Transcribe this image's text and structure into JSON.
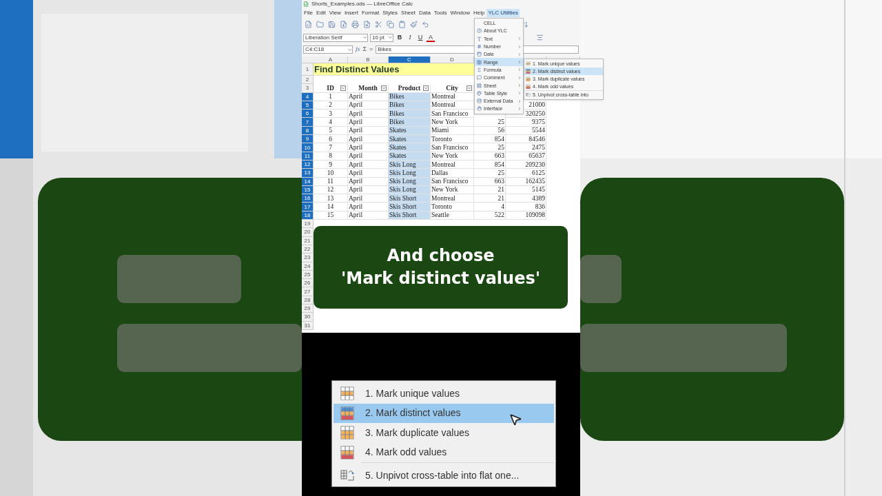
{
  "window": {
    "title": "Shorts_Examples.ods — LibreOffice Calc"
  },
  "menu_bar": [
    {
      "label": "File",
      "selected": false
    },
    {
      "label": "Edit",
      "selected": false
    },
    {
      "label": "View",
      "selected": false
    },
    {
      "label": "Insert",
      "selected": false
    },
    {
      "label": "Format",
      "selected": false
    },
    {
      "label": "Styles",
      "selected": false
    },
    {
      "label": "Sheet",
      "selected": false
    },
    {
      "label": "Data",
      "selected": false
    },
    {
      "label": "Tools",
      "selected": false
    },
    {
      "label": "Window",
      "selected": false
    },
    {
      "label": "Help",
      "selected": false
    },
    {
      "label": "YLC Utilities",
      "selected": true
    }
  ],
  "format_bar": {
    "font": "Liberation Serif",
    "size": "10 pt",
    "bold": "B",
    "italic": "I",
    "underline": "U",
    "font_color": "A"
  },
  "formula_bar": {
    "name_box": "C4:C18",
    "function_wizard": "fx",
    "sum": "Σ",
    "equals": "=",
    "content": "Bikes"
  },
  "sheet": {
    "columns": [
      {
        "label": "A",
        "selected": false
      },
      {
        "label": "B",
        "selected": false
      },
      {
        "label": "C",
        "selected": true
      },
      {
        "label": "D",
        "selected": false
      }
    ],
    "rows": [
      {
        "number": "1",
        "selected": false,
        "kind": "title",
        "title": "Find Distinct Values"
      },
      {
        "number": "2",
        "selected": false,
        "kind": "blank"
      },
      {
        "number": "3",
        "selected": false,
        "kind": "header",
        "cells": [
          "ID",
          "Month",
          "Product",
          "City"
        ]
      },
      {
        "number": "4",
        "selected": true,
        "kind": "data",
        "cells": [
          "1",
          "April",
          "Bikes",
          "Montreal"
        ]
      },
      {
        "number": "5",
        "selected": true,
        "kind": "data",
        "cells": [
          "2",
          "April",
          "Bikes",
          "Montreal"
        ],
        "column_6": "21000"
      },
      {
        "number": "6",
        "selected": true,
        "kind": "data",
        "cells": [
          "3",
          "April",
          "Bikes",
          "San Francisco"
        ],
        "column_6": "320250"
      },
      {
        "number": "7",
        "selected": true,
        "kind": "data",
        "cells": [
          "4",
          "April",
          "Bikes",
          "New York"
        ],
        "column_5": "25",
        "column_6": "9375"
      },
      {
        "number": "8",
        "selected": true,
        "kind": "data",
        "cells": [
          "5",
          "April",
          "Skates",
          "Miami"
        ],
        "column_5": "56",
        "column_6": "5544"
      },
      {
        "number": "9",
        "selected": true,
        "kind": "data",
        "cells": [
          "6",
          "April",
          "Skates",
          "Toronto"
        ],
        "column_5": "854",
        "column_6": "84546"
      },
      {
        "number": "10",
        "selected": true,
        "kind": "data",
        "cells": [
          "7",
          "April",
          "Skates",
          "San Francisco"
        ],
        "column_5": "25",
        "column_6": "2475"
      },
      {
        "number": "11",
        "selected": true,
        "kind": "data",
        "cells": [
          "8",
          "April",
          "Skates",
          "New York"
        ],
        "column_5": "663",
        "column_6": "65637"
      },
      {
        "number": "12",
        "selected": true,
        "kind": "data",
        "cells": [
          "9",
          "April",
          "Skis Long",
          "Montreal"
        ],
        "column_5": "854",
        "column_6": "209230"
      },
      {
        "number": "13",
        "selected": true,
        "kind": "data",
        "cells": [
          "10",
          "April",
          "Skis Long",
          "Dallas"
        ],
        "column_5": "25",
        "column_6": "6125"
      },
      {
        "number": "14",
        "selected": true,
        "kind": "data",
        "cells": [
          "11",
          "April",
          "Skis Long",
          "San Francisco"
        ],
        "column_5": "663",
        "column_6": "162435"
      },
      {
        "number": "15",
        "selected": true,
        "kind": "data",
        "cells": [
          "12",
          "April",
          "Skis Long",
          "New York"
        ],
        "column_5": "21",
        "column_6": "5145"
      },
      {
        "number": "16",
        "selected": true,
        "kind": "data",
        "cells": [
          "13",
          "April",
          "Skis Short",
          "Montreal"
        ],
        "column_5": "21",
        "column_6": "4389"
      },
      {
        "number": "17",
        "selected": true,
        "kind": "data",
        "cells": [
          "14",
          "April",
          "Skis Short",
          "Toronto"
        ],
        "column_5": "4",
        "column_6": "836"
      },
      {
        "number": "18",
        "selected": true,
        "kind": "data",
        "cells": [
          "15",
          "April",
          "Skis Short",
          "Seattle"
        ],
        "column_5": "522",
        "column_6": "109098"
      },
      {
        "number": "19",
        "selected": false,
        "kind": "blank"
      },
      {
        "number": "20",
        "selected": false,
        "kind": "blank"
      },
      {
        "number": "21",
        "selected": false,
        "kind": "blank"
      },
      {
        "number": "22",
        "selected": false,
        "kind": "blank"
      },
      {
        "number": "23",
        "selected": false,
        "kind": "blank"
      },
      {
        "number": "24",
        "selected": false,
        "kind": "blank"
      },
      {
        "number": "25",
        "selected": false,
        "kind": "blank"
      },
      {
        "number": "26",
        "selected": false,
        "kind": "blank"
      },
      {
        "number": "27",
        "selected": false,
        "kind": "blank"
      },
      {
        "number": "28",
        "selected": false,
        "kind": "blank"
      },
      {
        "number": "29",
        "selected": false,
        "kind": "blank"
      },
      {
        "number": "30",
        "selected": false,
        "kind": "blank"
      },
      {
        "number": "31",
        "selected": false,
        "kind": "blank"
      }
    ]
  },
  "ylc_menu": {
    "items": [
      {
        "label": "CELL",
        "submenu": false,
        "selected": false
      },
      {
        "label": "About YLC",
        "submenu": false,
        "selected": false
      },
      {
        "label": "Text",
        "submenu": true,
        "selected": false
      },
      {
        "label": "Number",
        "submenu": true,
        "selected": false
      },
      {
        "label": "Date",
        "submenu": true,
        "selected": false
      },
      {
        "label": "Range",
        "submenu": true,
        "selected": true
      },
      {
        "label": "Formula",
        "submenu": true,
        "selected": false
      },
      {
        "label": "Comment",
        "submenu": true,
        "selected": false
      },
      {
        "label": "Sheet",
        "submenu": true,
        "selected": false
      },
      {
        "label": "Table Style",
        "submenu": true,
        "selected": false
      },
      {
        "label": "External Data",
        "submenu": true,
        "selected": false
      },
      {
        "label": "Interface",
        "submenu": true,
        "selected": false
      }
    ]
  },
  "range_submenu": {
    "items": [
      {
        "label": "1. Mark unique values",
        "kind": "mark",
        "selected": false
      },
      {
        "label": "2. Mark distinct values",
        "kind": "mark",
        "selected": true
      },
      {
        "label": "3. Mark duplicate values",
        "kind": "mark",
        "selected": false
      },
      {
        "label": "4. Mark odd values",
        "kind": "mark",
        "selected": false
      },
      {
        "label": "5. Unpivot cross-table into",
        "kind": "unpivot",
        "selected": false
      }
    ]
  },
  "caption": {
    "lines": [
      "And choose",
      "'Mark distinct values'"
    ]
  },
  "zoomed_menu": {
    "items": [
      {
        "label": "1. Mark unique values",
        "kind": "mark",
        "selected": false
      },
      {
        "label": "2. Mark distinct values",
        "kind": "mark",
        "selected": true
      },
      {
        "label": "3. Mark duplicate values",
        "kind": "mark",
        "selected": false
      },
      {
        "label": "4. Mark odd values",
        "kind": "mark",
        "selected": false
      },
      {
        "label": "5. Unpivot cross-table into flat one...",
        "kind": "unpivot",
        "selected": false
      }
    ]
  }
}
